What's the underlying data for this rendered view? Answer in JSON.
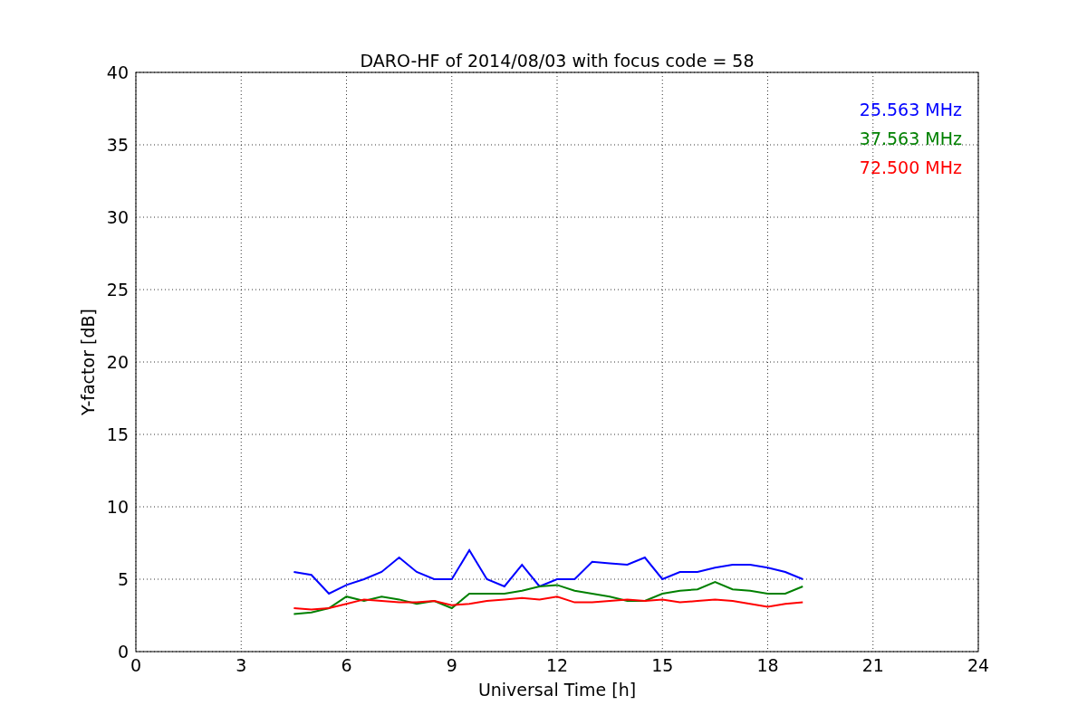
{
  "chart": {
    "chart_data": {
      "type": "line",
      "title": "DARO-HF of 2014/08/03 with focus code = 58",
      "xlabel": "Universal Time [h]",
      "ylabel": "Y-factor [dB]",
      "x": [
        4.5,
        5,
        5.5,
        6,
        6.5,
        7,
        7.5,
        8,
        8.5,
        9,
        9.5,
        10,
        10.5,
        11,
        11.5,
        12,
        12.5,
        13,
        13.5,
        14,
        14.5,
        15,
        15.5,
        16,
        16.5,
        17,
        17.5,
        18,
        18.5,
        19
      ],
      "series": [
        {
          "name": "25.563 MHz",
          "color": "#0000ff",
          "values": [
            5.5,
            5.3,
            4.0,
            4.6,
            5.0,
            5.5,
            6.5,
            5.5,
            5.0,
            5.0,
            7.0,
            5.0,
            4.5,
            6.0,
            4.5,
            5.0,
            5.0,
            6.2,
            6.1,
            6.0,
            6.5,
            5.0,
            5.5,
            5.5,
            5.8,
            6.0,
            6.0,
            5.8,
            5.5,
            5.0
          ]
        },
        {
          "name": "37.563 MHz",
          "color": "#008000",
          "values": [
            2.6,
            2.7,
            3.0,
            3.8,
            3.5,
            3.8,
            3.6,
            3.3,
            3.5,
            3.0,
            4.0,
            4.0,
            4.0,
            4.2,
            4.5,
            4.6,
            4.2,
            4.0,
            3.8,
            3.5,
            3.5,
            4.0,
            4.2,
            4.3,
            4.8,
            4.3,
            4.2,
            4.0,
            4.0,
            4.5
          ]
        },
        {
          "name": "72.500 MHz",
          "color": "#ff0000",
          "values": [
            3.0,
            2.9,
            3.0,
            3.3,
            3.6,
            3.5,
            3.4,
            3.4,
            3.5,
            3.2,
            3.3,
            3.5,
            3.6,
            3.7,
            3.6,
            3.8,
            3.4,
            3.4,
            3.5,
            3.6,
            3.5,
            3.6,
            3.4,
            3.5,
            3.6,
            3.5,
            3.3,
            3.1,
            3.3,
            3.4
          ]
        }
      ],
      "grid": true,
      "xlim": [
        0,
        24
      ],
      "ylim": [
        0,
        40
      ],
      "xticks": [
        0,
        3,
        6,
        9,
        12,
        15,
        18,
        21,
        24
      ],
      "yticks": [
        0,
        5,
        10,
        15,
        20,
        25,
        30,
        35,
        40
      ]
    }
  }
}
